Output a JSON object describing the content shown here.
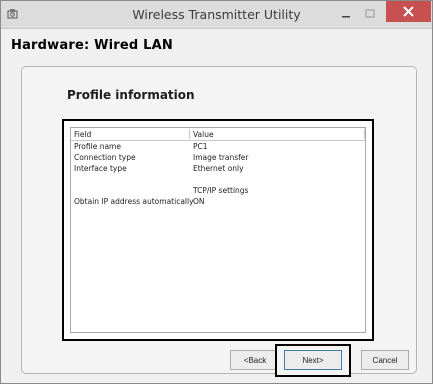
{
  "window": {
    "title": "Wireless Transmitter Utility"
  },
  "page": {
    "heading": "Hardware: Wired LAN",
    "section_title": "Profile information"
  },
  "table": {
    "columns": [
      "Field",
      "Value"
    ],
    "rows": [
      {
        "field": "Profile name",
        "value": "PC1"
      },
      {
        "field": "Connection type",
        "value": "Image transfer"
      },
      {
        "field": "Interface type",
        "value": "Ethernet only"
      },
      {
        "field": "",
        "value": ""
      },
      {
        "field": "",
        "value": "TCP/IP settings"
      },
      {
        "field": "Obtain IP address automatically",
        "value": "ON"
      }
    ]
  },
  "buttons": {
    "back": "<Back",
    "next": "Next>",
    "cancel": "Cancel"
  },
  "colors": {
    "close_button": "#c75050",
    "highlight_frame": "#000000",
    "titlebar": "#dcdcdc"
  }
}
